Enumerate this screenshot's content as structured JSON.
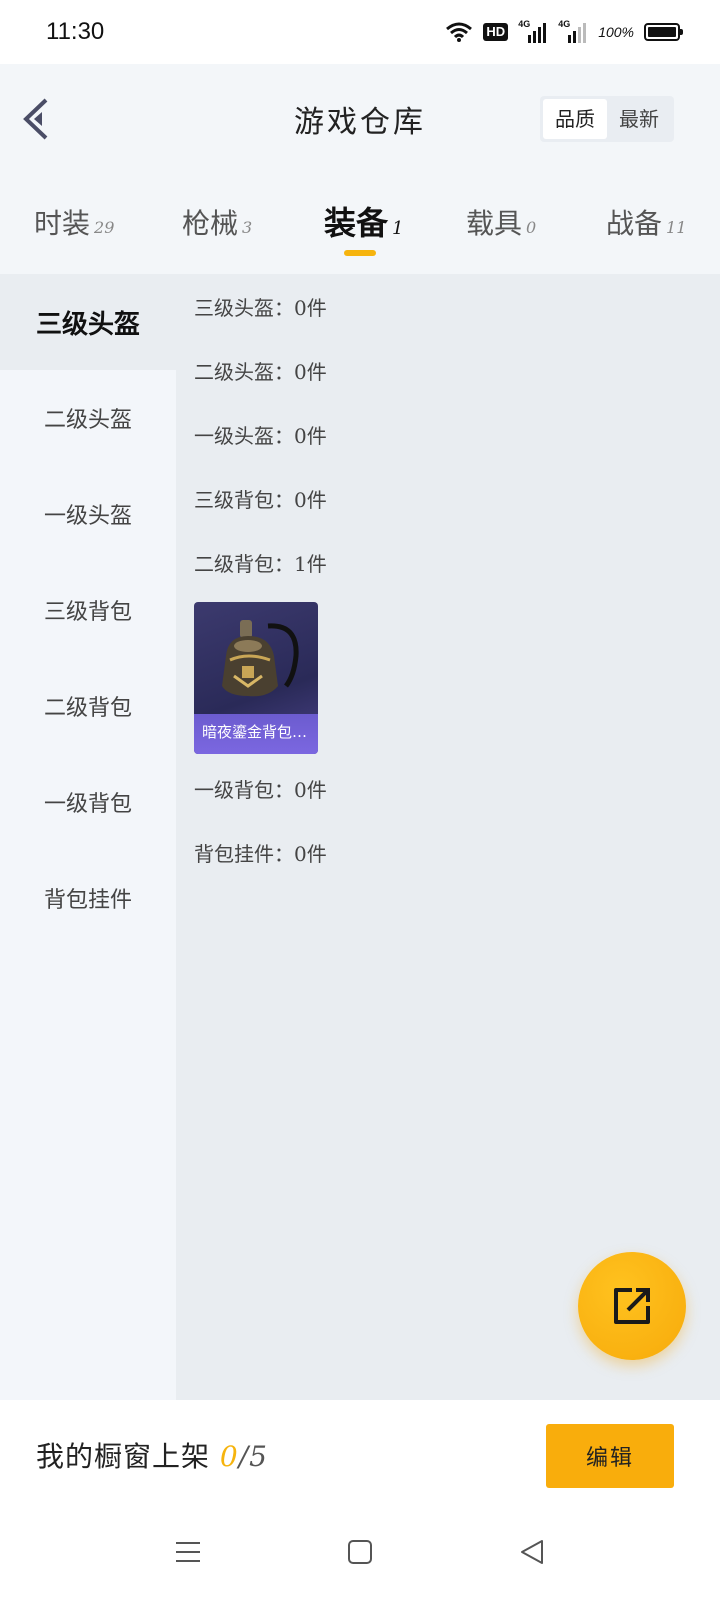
{
  "status_bar": {
    "time": "11:30",
    "icons": [
      "wifi-icon",
      "hd-icon",
      "signal-4g-icon",
      "signal-4g-icon",
      "battery-icon"
    ],
    "hd_label": "HD",
    "network_label_1": "4G",
    "network_label_2": "4G",
    "battery_percent": "100%"
  },
  "header": {
    "title": "游戏仓库",
    "sort_options": [
      "品质",
      "最新"
    ],
    "active_sort": "品质"
  },
  "tabs": [
    {
      "label": "时装",
      "count": "29"
    },
    {
      "label": "枪械",
      "count": "3"
    },
    {
      "label": "装备",
      "count": "1"
    },
    {
      "label": "载具",
      "count": "0"
    },
    {
      "label": "战备",
      "count": "11"
    }
  ],
  "active_tab": "装备",
  "sidebar": {
    "items": [
      {
        "label": "三级头盔"
      },
      {
        "label": "二级头盔"
      },
      {
        "label": "一级头盔"
      },
      {
        "label": "三级背包"
      },
      {
        "label": "二级背包"
      },
      {
        "label": "一级背包"
      },
      {
        "label": "背包挂件"
      }
    ],
    "active_item": "三级头盔"
  },
  "sections": [
    {
      "label": "三级头盔：0件"
    },
    {
      "label": "二级头盔：0件"
    },
    {
      "label": "一级头盔：0件"
    },
    {
      "label": "三级背包：0件"
    },
    {
      "label": "二级背包：1件"
    },
    {
      "label": "一级背包：0件"
    },
    {
      "label": "背包挂件：0件"
    }
  ],
  "item_card": {
    "name": "暗夜鎏金背包…",
    "icon": "backpack-icon"
  },
  "fab": {
    "icon": "share-icon"
  },
  "bottom_bar": {
    "shelf_label": "我的橱窗上架",
    "shelf_count": "0",
    "shelf_total": "/5",
    "edit_label": "编辑"
  },
  "nav_bar": {
    "icons": [
      "menu-icon",
      "home-icon",
      "back-triangle-icon"
    ]
  },
  "colors": {
    "accent": "#f6b40e",
    "card_bg": "#2f2d60",
    "card_caption": "#7163d8"
  }
}
